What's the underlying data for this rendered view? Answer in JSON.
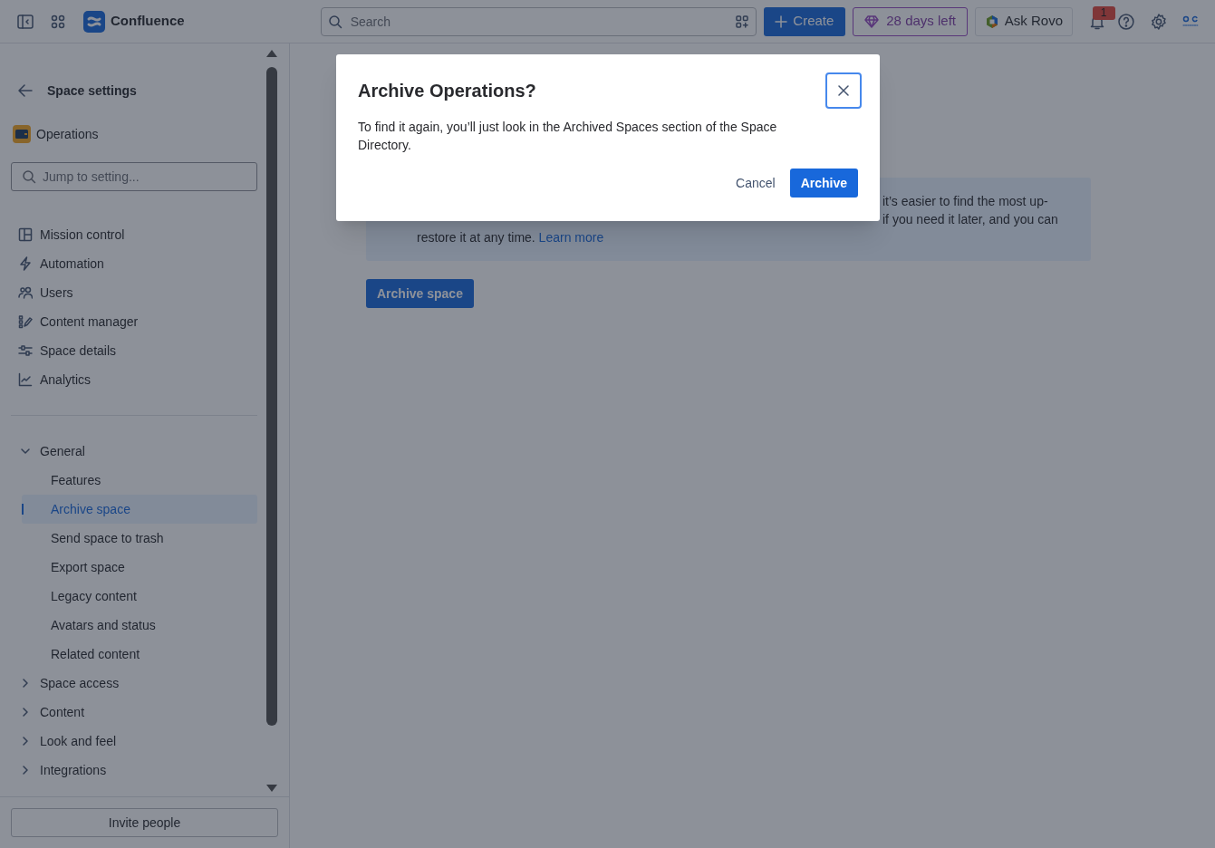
{
  "topbar": {
    "product": "Confluence",
    "search": {
      "placeholder": "Search"
    },
    "create": "Create",
    "trial": "28 days left",
    "ask": "Ask Rovo",
    "notifications": "1"
  },
  "sidebar": {
    "back": "Space settings",
    "space": "Operations",
    "search": {
      "placeholder": "Jump to setting..."
    },
    "items": [
      "Mission control",
      "Automation",
      "Users",
      "Content manager",
      "Space details",
      "Analytics"
    ],
    "sections": [
      {
        "label": "General",
        "expanded": true,
        "children": [
          {
            "label": "Features",
            "selected": false
          },
          {
            "label": "Archive space",
            "selected": true
          },
          {
            "label": "Send space to trash",
            "selected": false
          },
          {
            "label": "Export space",
            "selected": false
          },
          {
            "label": "Legacy content",
            "selected": false
          },
          {
            "label": "Avatars and status",
            "selected": false
          },
          {
            "label": "Related content",
            "selected": false
          }
        ]
      },
      {
        "label": "Space access",
        "expanded": false
      },
      {
        "label": "Content",
        "expanded": false
      },
      {
        "label": "Look and feel",
        "expanded": false
      },
      {
        "label": "Integrations",
        "expanded": false
      }
    ],
    "invite": "Invite people"
  },
  "main": {
    "info_lines": [
      "it’s easier to find the most up-",
      "if you need it later, and you can",
      "restore it at any time."
    ],
    "info_link": "Learn more",
    "archive_button": "Archive space"
  },
  "dialog": {
    "title": "Archive Operations?",
    "body": "To find it again, you’ll just look in the Archived Spaces section of the Space Directory.",
    "cancel": "Cancel",
    "confirm": "Archive"
  }
}
